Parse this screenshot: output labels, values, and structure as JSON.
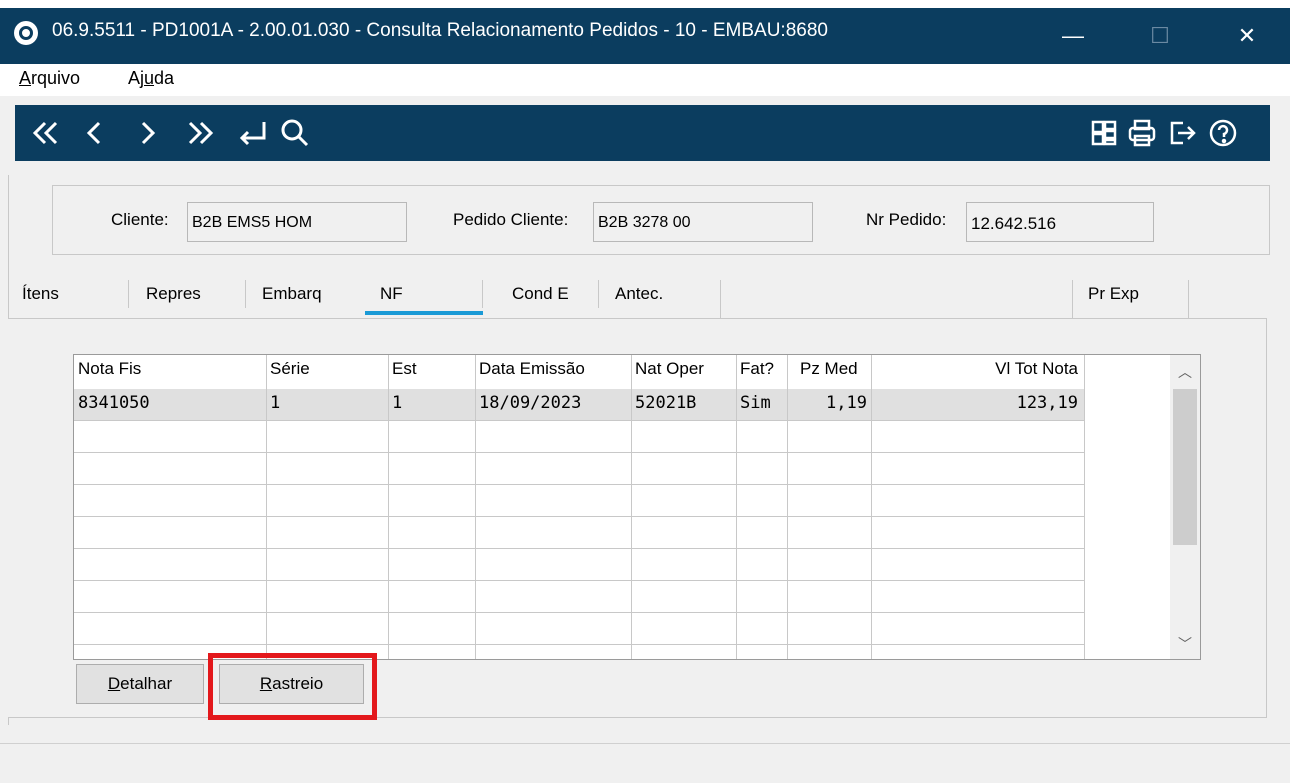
{
  "window": {
    "title": "06.9.5511 - PD1001A - 2.00.01.030 - Consulta Relacionamento Pedidos - 10 - EMBAU:8680",
    "minimize_glyph": "—",
    "maximize_glyph": "☐",
    "close_glyph": "✕"
  },
  "menu": {
    "arquivo": {
      "pre": "",
      "accel": "A",
      "post": "rquivo"
    },
    "ajuda": {
      "pre": "Aj",
      "accel": "u",
      "post": "da"
    }
  },
  "toolbar": {
    "icons": [
      "first-record-icon",
      "previous-record-icon",
      "next-record-icon",
      "last-record-icon",
      "go-to-icon",
      "search-icon",
      "layout-icon",
      "print-icon",
      "exit-icon",
      "help-icon"
    ]
  },
  "header": {
    "cliente_label": "Cliente:",
    "cliente_value": "B2B EMS5 HOM",
    "pedido_cliente_label": "Pedido Cliente:",
    "pedido_cliente_value": "B2B 3278 00",
    "nr_pedido_label": "Nr Pedido:",
    "nr_pedido_value": "12.642.516"
  },
  "tabs": [
    {
      "label": "Ítens"
    },
    {
      "label": "Repres"
    },
    {
      "label": "Embarq"
    },
    {
      "label": "NF"
    },
    {
      "label": "Cond E"
    },
    {
      "label": "Antec."
    },
    {
      "label": "Pr Exp"
    }
  ],
  "active_tab": "NF",
  "grid": {
    "columns": [
      "Nota Fis",
      "Série",
      "Est",
      "Data Emissão",
      "Nat Oper",
      "Fat?",
      "Pz Med",
      "Vl Tot Nota"
    ],
    "rows": [
      [
        "8341050",
        "1",
        "1",
        "18/09/2023",
        "52021B",
        "Sim",
        "1,19",
        "123,19"
      ]
    ],
    "scroll_up_glyph": "︿",
    "scroll_down_glyph": "﹀"
  },
  "buttons": {
    "detalhar": {
      "pre": "",
      "accel": "D",
      "post": "etalhar"
    },
    "rastreio": {
      "pre": "",
      "accel": "R",
      "post": "astreio"
    }
  },
  "colors": {
    "titlebar": "#0b3d5f",
    "toolbar": "#0b3d5f",
    "active_tab_underline": "#1a9ad6",
    "highlight": "#e3181c"
  }
}
